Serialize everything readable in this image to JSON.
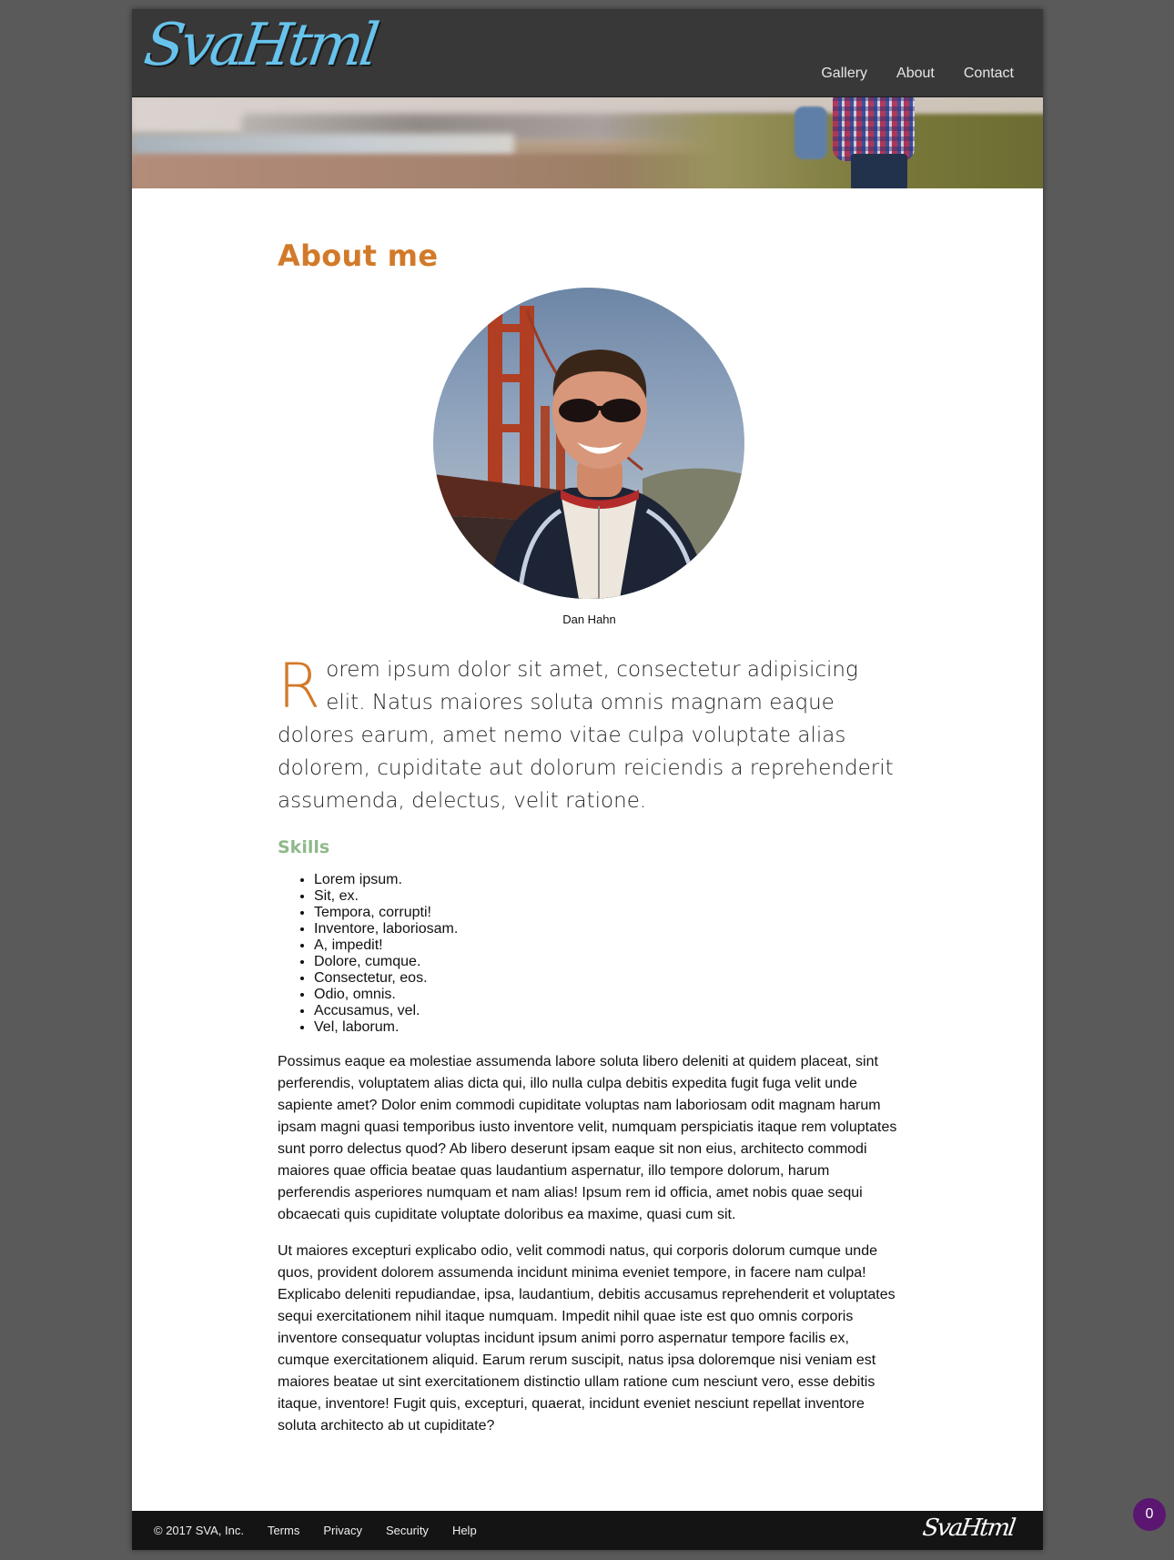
{
  "site": {
    "logo_text": "SvaHtml",
    "nav": [
      {
        "label": "Gallery"
      },
      {
        "label": "About"
      },
      {
        "label": "Contact"
      }
    ]
  },
  "main": {
    "heading": "About me",
    "avatar_caption": "Dan Hahn",
    "lead_dropcap": "R",
    "lead_text": "orem ipsum dolor sit amet, consectetur adipisicing elit. Natus maiores soluta omnis magnam eaque dolores earum, amet nemo vitae culpa voluptate alias dolorem, cupiditate aut dolorum reiciendis a reprehenderit assumenda, delectus, velit ratione.",
    "skills_heading": "Skills",
    "skills": [
      "Lorem ipsum.",
      "Sit, ex.",
      "Tempora, corrupti!",
      "Inventore, laboriosam.",
      "A, impedit!",
      "Dolore, cumque.",
      "Consectetur, eos.",
      "Odio, omnis.",
      "Accusamus, vel.",
      "Vel, laborum."
    ],
    "paragraph_1": "Possimus eaque ea molestiae assumenda labore soluta libero deleniti at quidem placeat, sint perferendis, voluptatem alias dicta qui, illo nulla culpa debitis expedita fugit fuga velit unde sapiente amet? Dolor enim commodi cupiditate voluptas nam laboriosam odit magnam harum ipsam magni quasi temporibus iusto inventore velit, numquam perspiciatis itaque rem voluptates sunt porro delectus quod? Ab libero deserunt ipsam eaque sit non eius, architecto commodi maiores quae officia beatae quas laudantium aspernatur, illo tempore dolorum, harum perferendis asperiores numquam et nam alias! Ipsum rem id officia, amet nobis quae sequi obcaecati quis cupiditate voluptate doloribus ea maxime, quasi cum sit.",
    "paragraph_2": "Ut maiores excepturi explicabo odio, velit commodi natus, qui corporis dolorum cumque unde quos, provident dolorem assumenda incidunt minima eveniet tempore, in facere nam culpa! Explicabo deleniti repudiandae, ipsa, laudantium, debitis accusamus reprehenderit et voluptates sequi exercitationem nihil itaque numquam. Impedit nihil quae iste est quo omnis corporis inventore consequatur voluptas incidunt ipsum animi porro aspernatur tempore facilis ex, cumque exercitationem aliquid. Earum rerum suscipit, natus ipsa doloremque nisi veniam est maiores beatae ut sint exercitationem distinctio ullam ratione cum nesciunt vero, esse debitis itaque, inventore! Fugit quis, excepturi, quaerat, incidunt eveniet nesciunt repellat inventore soluta architecto ab ut cupiditate?"
  },
  "footer": {
    "copyright": "© 2017 SVA, Inc.",
    "links": [
      {
        "label": "Terms"
      },
      {
        "label": "Privacy"
      },
      {
        "label": "Security"
      },
      {
        "label": "Help"
      }
    ],
    "logo_text": "SvaHtml"
  },
  "badge": {
    "count": "0"
  },
  "colors": {
    "accent_orange": "#d27a2a",
    "skills_green": "#8fb98a",
    "logo_blue": "#67c3ec",
    "header_bg": "#383838",
    "footer_bg": "#141414",
    "badge_purple": "#5a1670"
  }
}
